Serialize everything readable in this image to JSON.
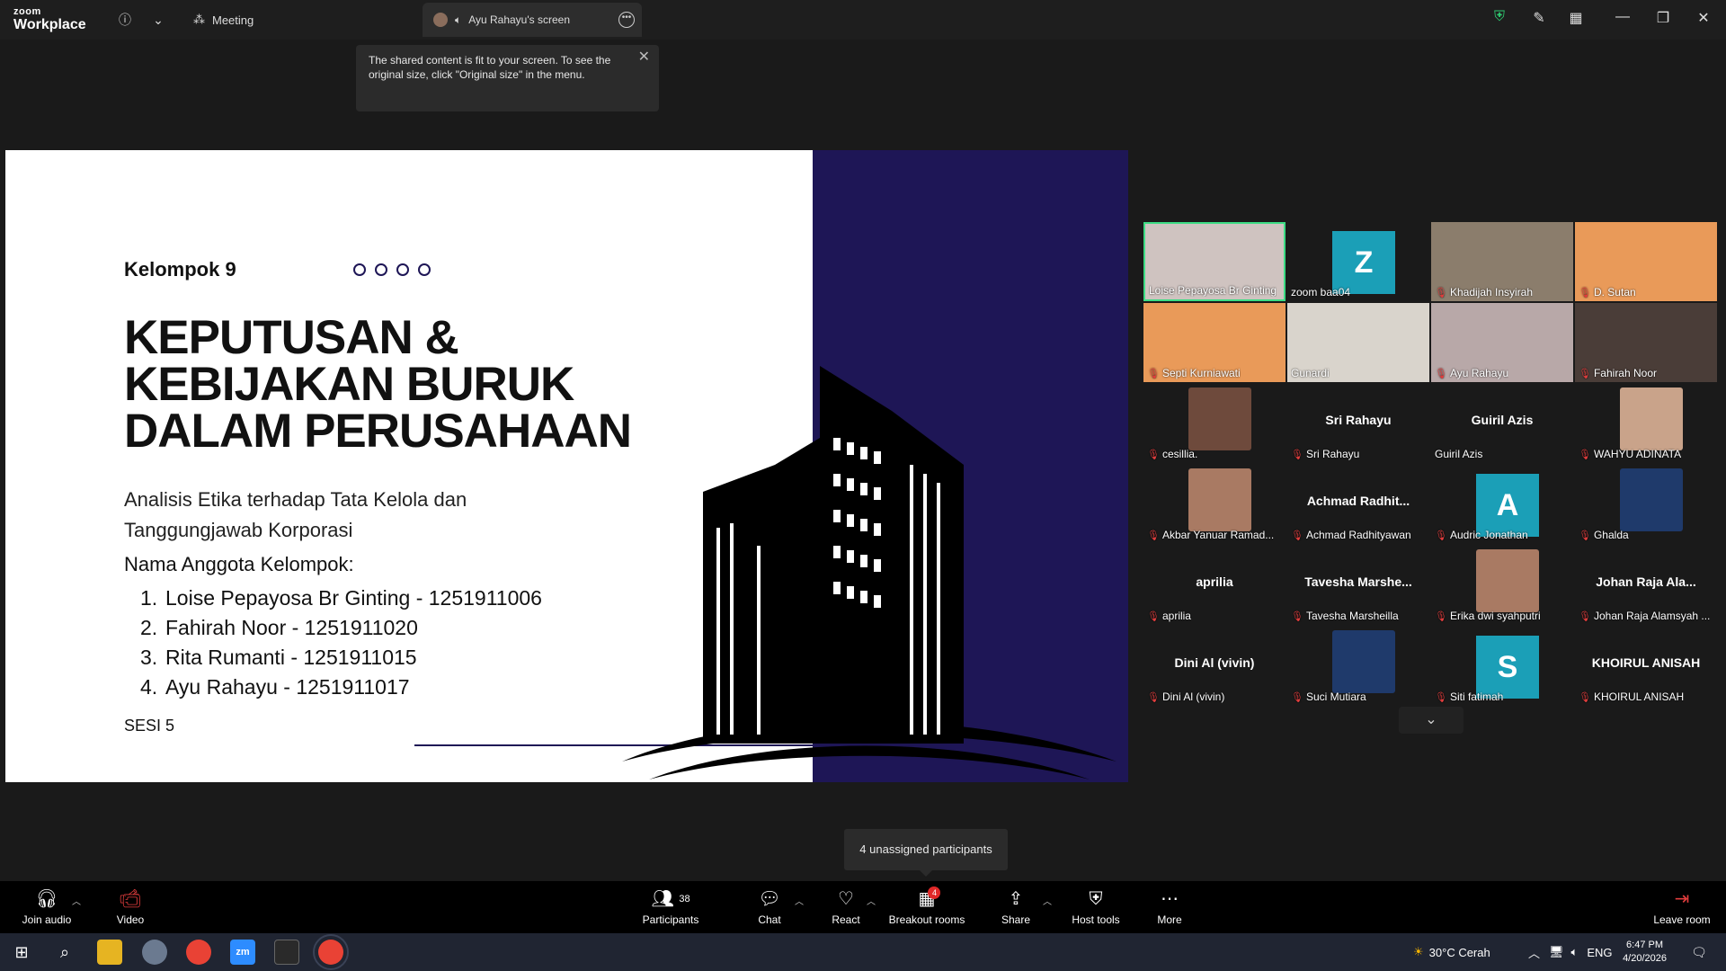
{
  "titlebar": {
    "logo_top": "zoom",
    "logo_bottom": "Workplace",
    "meeting_tab": "Meeting",
    "screen_tab": "Ayu Rahayu's screen"
  },
  "tooltip": {
    "text": "The shared content is fit to your screen. To see the original size, click \"Original size\" in the menu."
  },
  "slide": {
    "group": "Kelompok 9",
    "title_lines": [
      "KEPUTUSAN &",
      "KEBIJAKAN BURUK",
      "DALAM PERUSAHAAN"
    ],
    "subtitle_lines": [
      "Analisis Etika terhadap Tata Kelola dan",
      "Tanggungjawab Korporasi"
    ],
    "members_head": "Nama Anggota Kelompok:",
    "members": [
      {
        "num": "1.",
        "text": "Loise Pepayosa Br Ginting - 1251911006"
      },
      {
        "num": "2.",
        "text": "Fahirah Noor - 1251911020"
      },
      {
        "num": "3.",
        "text": "Rita Rumanti - 1251911015"
      },
      {
        "num": "4.",
        "text": "Ayu Rahayu - 1251911017"
      }
    ],
    "session": "SESI 5",
    "colors": {
      "accent": "#1e1656"
    }
  },
  "gallery": [
    {
      "name": "Loise Pepayosa Br Ginting",
      "kind": "video",
      "muted": false,
      "active": true
    },
    {
      "name": "zoom baa04",
      "kind": "letter",
      "letter": "Z",
      "muted": false
    },
    {
      "name": "Khadijah Insyirah",
      "kind": "video",
      "muted": true
    },
    {
      "name": "D. Sutan",
      "kind": "video",
      "muted": true
    },
    {
      "name": "Septi Kurniawati",
      "kind": "video",
      "muted": true
    },
    {
      "name": "Gunardi",
      "kind": "video",
      "muted": false
    },
    {
      "name": "Ayu Rahayu",
      "kind": "video",
      "muted": true
    },
    {
      "name": "Fahirah Noor",
      "kind": "video",
      "muted": true
    },
    {
      "name": "cesillia.",
      "kind": "photo",
      "muted": true
    },
    {
      "name": "Sri Rahayu",
      "kind": "bigname",
      "big": "Sri Rahayu",
      "muted": true
    },
    {
      "name": "Guiril Azis",
      "kind": "bigname",
      "big": "Guiril Azis",
      "muted": false
    },
    {
      "name": "WAHYU ADINATA",
      "kind": "photo",
      "muted": true
    },
    {
      "name": "Akbar Yanuar Ramad...",
      "kind": "photo",
      "muted": true
    },
    {
      "name": "Achmad Radhityawan",
      "kind": "bigname",
      "big": "Achmad Radhit...",
      "muted": true
    },
    {
      "name": "Audric Jonathan",
      "kind": "letter",
      "letter": "A",
      "muted": true
    },
    {
      "name": "Ghalda",
      "kind": "photo",
      "muted": true
    },
    {
      "name": "aprilia",
      "kind": "bigname",
      "big": "aprilia",
      "muted": true
    },
    {
      "name": "Tavesha Marsheilla",
      "kind": "bigname",
      "big": "Tavesha Marshe...",
      "muted": true
    },
    {
      "name": "Erika dwi syahputri",
      "kind": "photo",
      "muted": true
    },
    {
      "name": "Johan Raja Alamsyah ...",
      "kind": "bigname",
      "big": "Johan Raja Ala...",
      "muted": true
    },
    {
      "name": "Dini Al (vivin)",
      "kind": "bigname",
      "big": "Dini Al (vivin)",
      "muted": true
    },
    {
      "name": "Suci Mutiara",
      "kind": "photo",
      "muted": true
    },
    {
      "name": "Siti fatimah",
      "kind": "letter",
      "letter": "S",
      "muted": true
    },
    {
      "name": "KHOIRUL ANISAH",
      "kind": "bigname",
      "big": "KHOIRUL ANISAH",
      "muted": true
    }
  ],
  "unassigned": "4 unassigned participants",
  "toolbar": {
    "join_audio": "Join audio",
    "video": "Video",
    "participants": "Participants",
    "participants_count": "38",
    "chat": "Chat",
    "react": "React",
    "breakout": "Breakout rooms",
    "breakout_badge": "4",
    "share": "Share",
    "host_tools": "Host tools",
    "more": "More",
    "leave": "Leave room"
  },
  "taskbar": {
    "weather": "30°C  Cerah",
    "lang": "ENG",
    "time": "6:47 PM",
    "date": "4/20/2026",
    "notif": "1"
  }
}
